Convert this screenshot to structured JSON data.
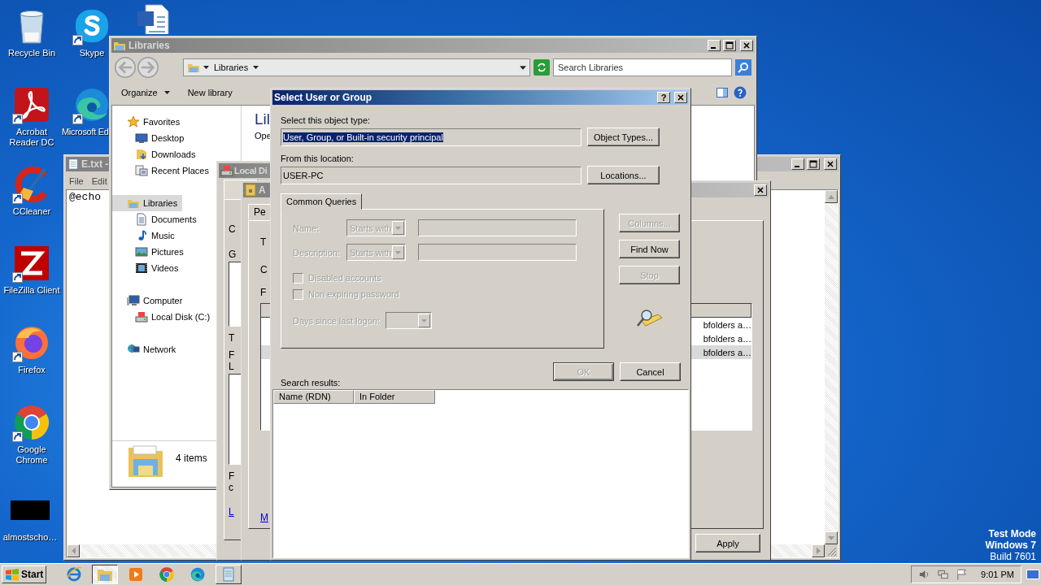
{
  "desktop": {
    "icons": [
      {
        "label": "Recycle Bin",
        "kind": "recycle",
        "shortcut": false
      },
      {
        "label": "Skype",
        "kind": "skype",
        "shortcut": true
      },
      {
        "kind": "word",
        "shortcut": false
      },
      {
        "label": "Acrobat Reader DC",
        "kind": "acrobat",
        "shortcut": true
      },
      {
        "label": "Microsoft Ed",
        "kind": "edge",
        "shortcut": true
      },
      {
        "label": "CCleaner",
        "kind": "ccleaner",
        "shortcut": true
      },
      {
        "label": "FileZilla Client",
        "kind": "filezilla",
        "shortcut": true
      },
      {
        "label": "Firefox",
        "kind": "firefox",
        "shortcut": true
      },
      {
        "label": "Google Chrome",
        "kind": "chrome",
        "shortcut": true
      },
      {
        "label": "almostscho…",
        "kind": "blank",
        "shortcut": false
      }
    ],
    "os_notice": [
      "Test Mode",
      "Windows 7",
      "Build 7601"
    ]
  },
  "notepad": {
    "title": "E.txt -",
    "menu": [
      "File",
      "Edit"
    ],
    "text": "@echo"
  },
  "explorer": {
    "title": "Libraries",
    "address": "Libraries",
    "search": {
      "placeholder": "Search Libraries"
    },
    "toolbar": [
      "Organize",
      "New library"
    ],
    "nav": [
      {
        "label": "Favorites",
        "selected": false,
        "children": [
          {
            "label": "Desktop",
            "selected": false
          },
          {
            "label": "Downloads",
            "selected": false
          },
          {
            "label": "Recent Places",
            "selected": false
          }
        ]
      },
      {
        "label": "Libraries",
        "selected": true,
        "children": [
          {
            "label": "Documents",
            "selected": false
          },
          {
            "label": "Music",
            "selected": false
          },
          {
            "label": "Pictures",
            "selected": false
          },
          {
            "label": "Videos",
            "selected": false
          }
        ]
      },
      {
        "label": "Computer",
        "selected": false,
        "children": [
          {
            "label": "Local Disk (C:)",
            "selected": false
          }
        ]
      },
      {
        "label": "Network",
        "selected": false
      }
    ],
    "content_heading": "Lil",
    "content_subtext": "Ope",
    "status": "4 items"
  },
  "local_disk_properties": {
    "title": "Local Di",
    "fragments": [
      {
        "kind": "text",
        "text": "C"
      },
      {
        "kind": "text",
        "text": "G"
      },
      {
        "kind": "box"
      },
      {
        "kind": "text",
        "text": "T"
      },
      {
        "kind": "text",
        "text": "F"
      },
      {
        "kind": "text",
        "text": "L"
      },
      {
        "kind": "box"
      },
      {
        "kind": "text",
        "text": "F"
      },
      {
        "kind": "text",
        "text": "c"
      },
      {
        "kind": "link",
        "text": "L"
      }
    ]
  },
  "advanced_security": {
    "title": "A",
    "tab": "Pe",
    "fragments": [
      {
        "kind": "text",
        "text": "T"
      },
      {
        "kind": "text",
        "text": "C"
      },
      {
        "kind": "text",
        "text": "F"
      }
    ],
    "rows": [
      {
        "text": "bfolders a…",
        "selected": false
      },
      {
        "text": "bfolders a…",
        "selected": false
      },
      {
        "text": "bfolders a…",
        "selected": true
      }
    ],
    "link": "M",
    "button": "Apply"
  },
  "select_dialog": {
    "title": "Select User or Group",
    "help_button": "?",
    "object_type": {
      "label": "Select this object type:",
      "value": "User, Group, or Built-in security principal",
      "highlighted": true,
      "button": "Object Types..."
    },
    "location": {
      "label": "From this location:",
      "value": "USER-PC",
      "button": "Locations..."
    },
    "tabs": [
      {
        "label": "Common Queries",
        "selected": true
      }
    ],
    "query": {
      "fields": [
        {
          "label": "Name:",
          "operator": "Starts with",
          "disabled": true
        },
        {
          "label": "Description:",
          "operator": "Starts with",
          "disabled": true
        }
      ],
      "checkboxes": [
        {
          "label": "Disabled accounts",
          "checked": false,
          "disabled": true
        },
        {
          "label": "Non expiring password",
          "checked": false,
          "disabled": true
        }
      ],
      "days": {
        "label": "Days since last logon:",
        "disabled": true
      }
    },
    "side_buttons": [
      {
        "label": "Columns...",
        "disabled": true
      },
      {
        "label": "Find Now",
        "disabled": false
      },
      {
        "label": "Stop",
        "disabled": true
      }
    ],
    "ok": {
      "label": "OK",
      "disabled": true
    },
    "cancel": {
      "label": "Cancel",
      "disabled": false
    },
    "results_label": "Search results:",
    "columns": [
      "Name (RDN)",
      "In Folder"
    ]
  },
  "taskbar": {
    "start": "Start",
    "apps": [
      {
        "kind": "ie",
        "running": false,
        "selected": false
      },
      {
        "kind": "explorer",
        "running": true,
        "selected": true
      },
      {
        "kind": "media",
        "running": false,
        "selected": false
      },
      {
        "kind": "chrome",
        "running": false,
        "selected": false
      },
      {
        "kind": "edge",
        "running": false,
        "selected": false
      },
      {
        "kind": "notepad",
        "running": true,
        "selected": false
      }
    ],
    "clock": "9:01 PM"
  }
}
